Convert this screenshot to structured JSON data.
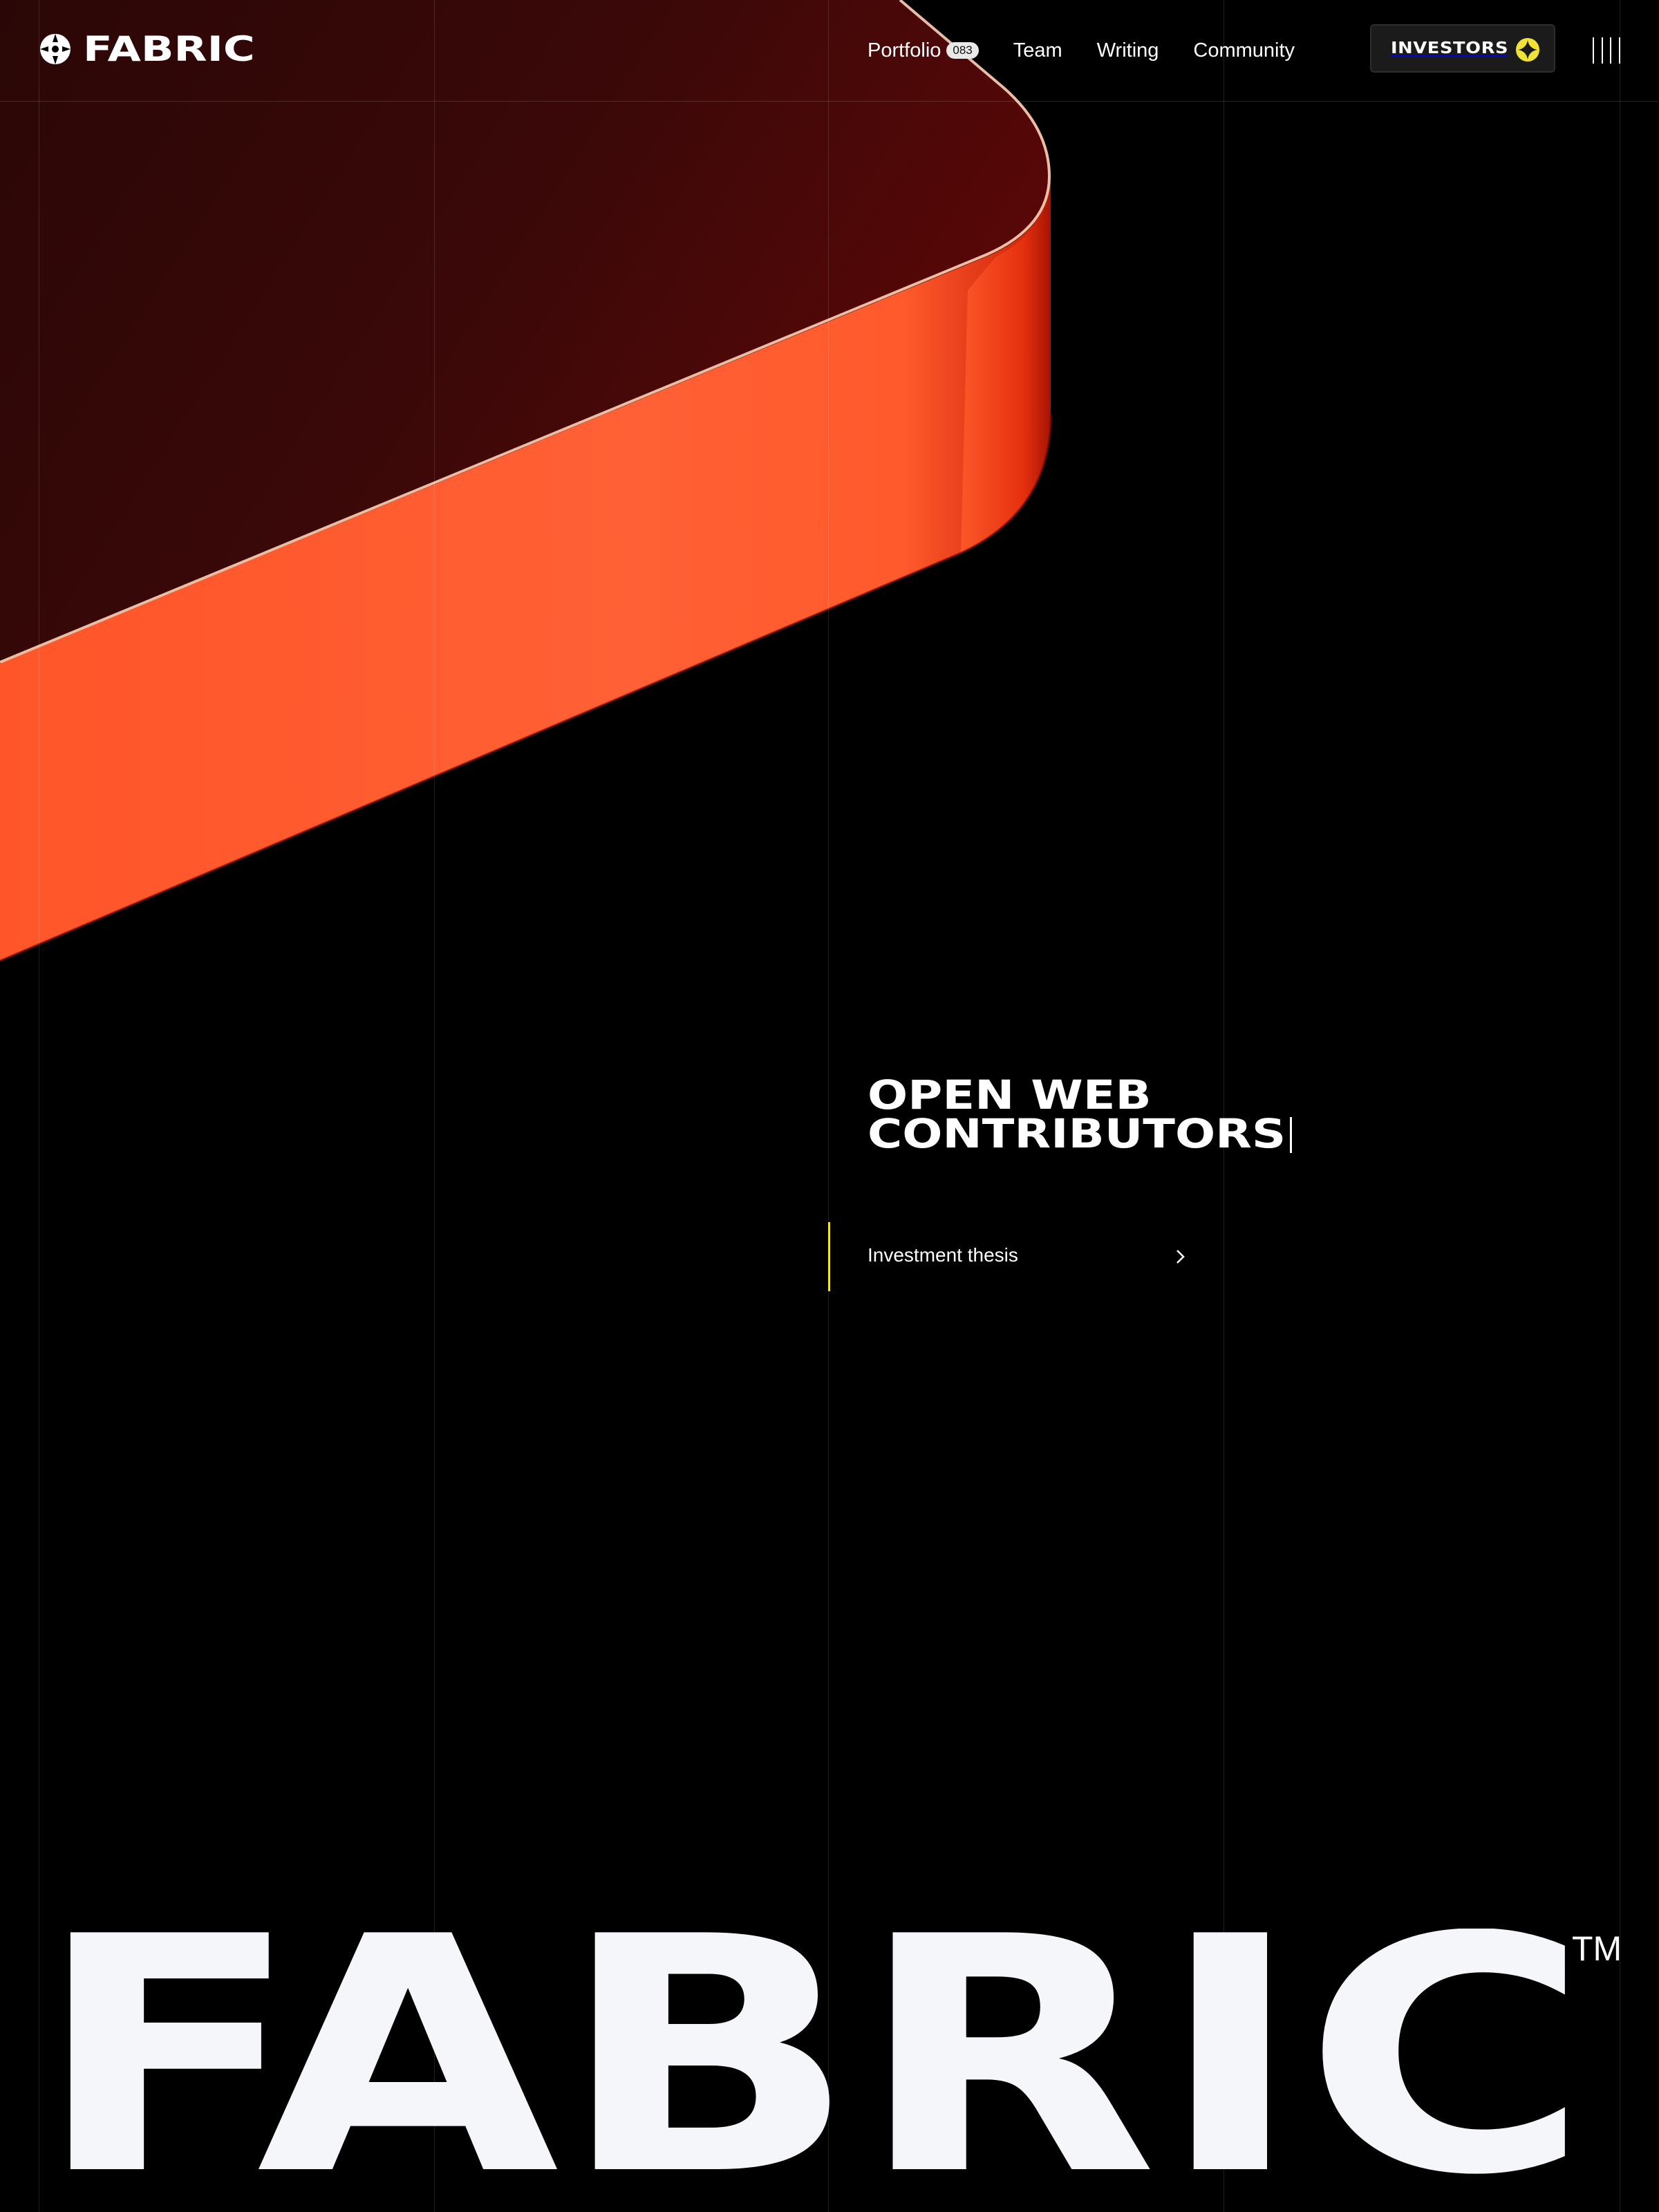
{
  "brand": {
    "name": "FABRIC",
    "wordmark": "FABRIC",
    "trademark": "TM"
  },
  "nav": {
    "items": [
      {
        "label": "Portfolio",
        "badge": "083"
      },
      {
        "label": "Team"
      },
      {
        "label": "Writing"
      },
      {
        "label": "Community"
      }
    ]
  },
  "investors_button": {
    "label": "INVESTORS",
    "icon": "star-badge-icon"
  },
  "menu": {
    "icon": "menu-bars-icon"
  },
  "hero": {
    "headline": [
      "OPEN WEB",
      "CONTRIBUTORS"
    ],
    "link_label": "Investment thesis",
    "link_icon": "chevron-right-icon"
  },
  "colors": {
    "background": "#000000",
    "accent_orange": "#ff5a2e",
    "panel_dark_red": "#3a0a08",
    "accent_yellow": "#f0e335",
    "wordmark": "#f5f6fa"
  }
}
